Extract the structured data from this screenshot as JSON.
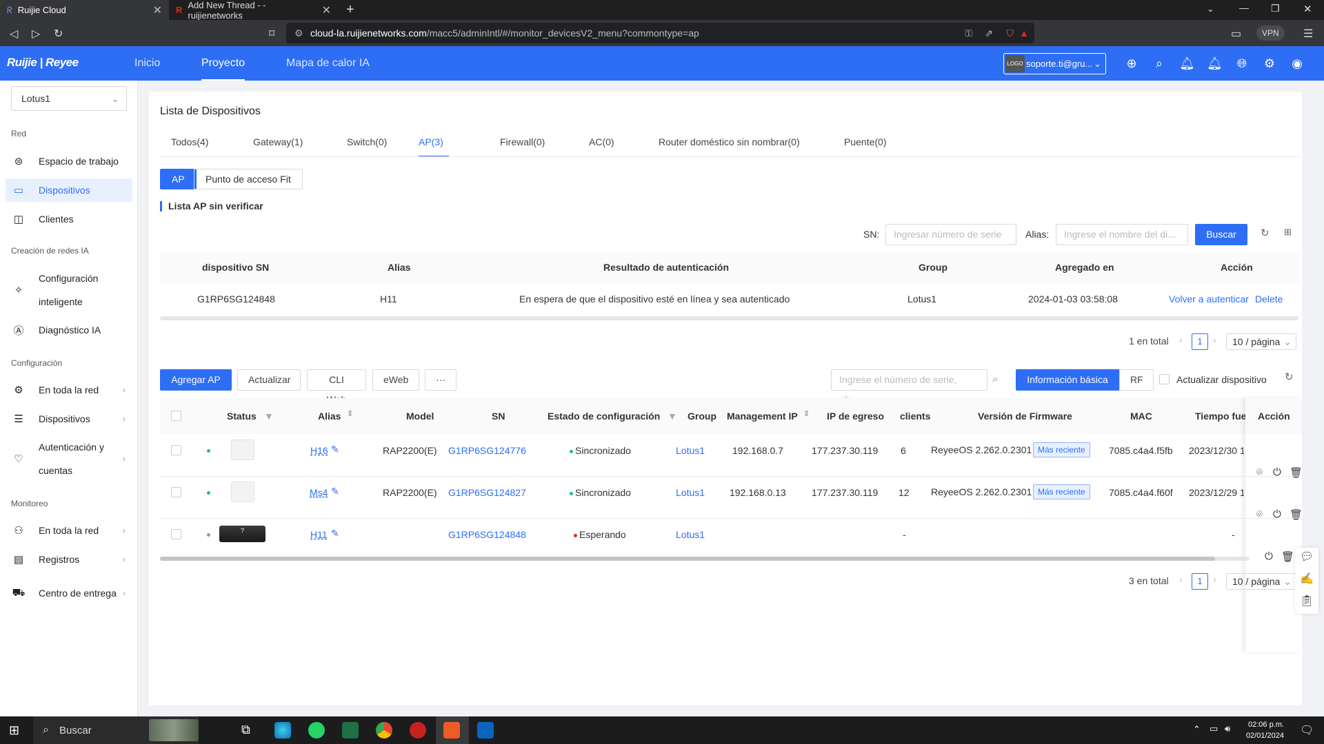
{
  "browser": {
    "tabs": [
      {
        "title": "Ruijie Cloud"
      },
      {
        "title": "Add New Thread - - ruijienetworks"
      }
    ],
    "new_tab": "+",
    "url_host": "cloud-la.ruijienetworks.com",
    "url_path": "/macc5/adminIntl/#/monitor_devicesV2_menu?commontype=ap",
    "vpn_label": "VPN"
  },
  "header": {
    "logo": "Ruijie | Reyee",
    "nav": [
      {
        "label": "Inicio"
      },
      {
        "label": "Proyecto"
      },
      {
        "label": "Mapa de calor IA"
      }
    ],
    "account_logo": "LOGO",
    "account": "soporte.ti@gru..."
  },
  "sidebar": {
    "project": "Lotus1",
    "sections": {
      "red": "Red",
      "ia": "Creación de redes IA",
      "config": "Configuración",
      "monitoreo": "Monitoreo"
    },
    "items": {
      "espacio": "Espacio de trabajo",
      "dispositivos": "Dispositivos",
      "clientes": "Clientes",
      "config_int_1": "Configuración",
      "config_int_2": "inteligente",
      "diag": "Diagnóstico IA",
      "toda_red": "En toda la red",
      "dispositivos2": "Dispositivos",
      "auth_1": "Autenticación y",
      "auth_2": "cuentas",
      "toda_red2": "En toda la red",
      "registros": "Registros",
      "entrega": "Centro de entrega"
    }
  },
  "main": {
    "title": "Lista de Dispositivos",
    "tabs": [
      "Todos(4)",
      "Gateway(1)",
      "Switch(0)",
      "AP(3)",
      "Firewall(0)",
      "AC(0)",
      "Router doméstico sin nombrar(0)",
      "Puente(0)"
    ],
    "seg": [
      "AP",
      "Punto de acceso Fit"
    ],
    "unverified": {
      "title": "Lista AP sin verificar",
      "sn_label": "SN:",
      "sn_placeholder": "Ingresar número de serie",
      "alias_label": "Alias:",
      "alias_placeholder": "Ingrese el nombre del di...",
      "search": "Buscar",
      "headers": [
        "dispositivo SN",
        "Alias",
        "Resultado de autenticación",
        "Group",
        "Agregado en",
        "Acción"
      ],
      "row": {
        "sn": "G1RP6SG124848",
        "alias": "H11",
        "result": "En espera de que el dispositivo esté en línea y sea autenticado",
        "group": "Lotus1",
        "added": "2024-01-03 03:58:08",
        "reauth": "Volver a autenticar",
        "delete": "Delete"
      },
      "total": "1 en total",
      "page": "1",
      "per_page": "10 / página"
    },
    "toolbar": {
      "add": "Agregar AP",
      "update": "Actualizar",
      "cli": "CLI Web",
      "eweb": "eWeb",
      "more": "···",
      "search_placeholder": "Ingrese el número de serie, alia...",
      "info": "Información básica",
      "rf": "RF",
      "upgrade": "Actualizar dispositivo"
    },
    "devices": {
      "headers": {
        "status": "Status",
        "alias": "Alias",
        "model": "Model",
        "sn": "SN",
        "config": "Estado de configuración",
        "group": "Group",
        "mgmt": "Management IP",
        "egress": "IP de egreso",
        "clients": "clients",
        "fw": "Versión de Firmware",
        "mac": "MAC",
        "time": "Tiempo fuera",
        "action": "Acción"
      },
      "rows": [
        {
          "alias": "H16",
          "model": "RAP2200(E)",
          "sn": "G1RP6SG124776",
          "config": "Sincronizado",
          "group": "Lotus1",
          "mgmt": "192.168.0.7",
          "egress": "177.237.30.119",
          "clients": "6",
          "fw": "ReyeeOS 2.262.0.2301",
          "badge": "Más reciente",
          "mac": "7085.c4a4.f5fb",
          "time": "2023/12/30 1"
        },
        {
          "alias": "Ms4",
          "model": "RAP2200(E)",
          "sn": "G1RP6SG124827",
          "config": "Sincronizado",
          "group": "Lotus1",
          "mgmt": "192.168.0.13",
          "egress": "177.237.30.119",
          "clients": "12",
          "fw": "ReyeeOS 2.262.0.2301",
          "badge": "Más reciente",
          "mac": "7085.c4a4.f60f",
          "time": "2023/12/29 1"
        },
        {
          "alias": "H11",
          "model": "",
          "sn": "G1RP6SG124848",
          "config": "Esperando",
          "group": "Lotus1",
          "mgmt": "",
          "egress": "",
          "clients": "-",
          "fw": "",
          "badge": "",
          "mac": "",
          "time": "-"
        }
      ],
      "total": "3 en total",
      "page": "1",
      "per_page": "10 / página"
    }
  },
  "taskbar": {
    "search": "Buscar",
    "time": "02:06 p.m.",
    "date": "02/01/2024"
  },
  "colors": {
    "primary": "#2d6ef5",
    "online": "#1dbf73",
    "offline": "#999999",
    "waiting": "#e0281f"
  }
}
